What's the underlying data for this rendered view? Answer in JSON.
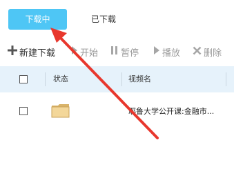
{
  "tabs": {
    "downloading": "下载中",
    "downloaded": "已下载"
  },
  "toolbar": {
    "new_download": "新建下载",
    "start": "开始",
    "pause": "暂停",
    "play": "播放",
    "delete": "删除"
  },
  "table": {
    "headers": [
      "状态",
      "视频名"
    ],
    "rows": [
      {
        "name": "耶鲁大学公开课:金融市..."
      }
    ]
  },
  "colors": {
    "active_tab": "#4ec6f5",
    "header_bg": "#e6f2fb",
    "annotation_arrow": "#e8372d"
  },
  "icons": [
    "plus-icon",
    "start-icon",
    "pause-icon",
    "play-icon",
    "delete-icon",
    "folder-icon"
  ]
}
